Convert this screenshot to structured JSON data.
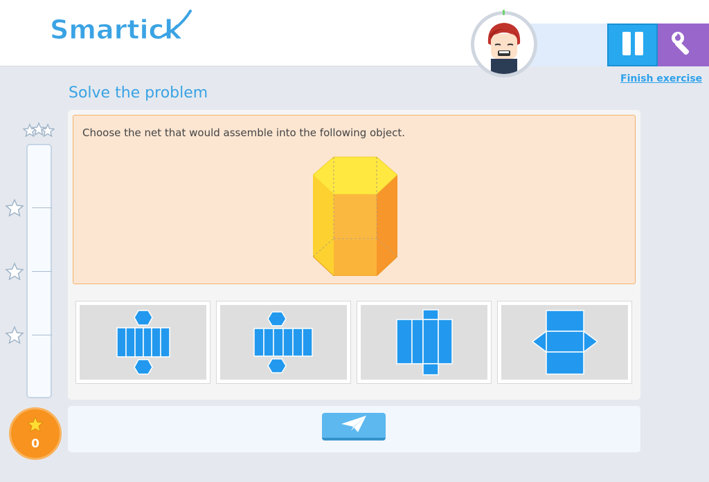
{
  "app": {
    "logo_text": "Smartick"
  },
  "header": {
    "finish_label": "Finish exercise",
    "pause_icon": "pause-icon",
    "settings_icon": "wrench-icon",
    "colors": {
      "pause": "#27a8ef",
      "settings": "#9966cc"
    }
  },
  "main": {
    "title": "Solve the problem",
    "question": "Choose the net that would assemble into the following object.",
    "object_icon": "hexagonal-prism",
    "options": [
      {
        "id": "A",
        "icon": "net-hexagonal-prism"
      },
      {
        "id": "B",
        "icon": "net-hexagonal-prism-variant"
      },
      {
        "id": "C",
        "icon": "net-rectangular-prism"
      },
      {
        "id": "D",
        "icon": "net-triangular-prism"
      }
    ]
  },
  "progress": {
    "milestone_stars": [
      "1-star",
      "2-star",
      "3-star"
    ],
    "goal_stars": "3-star",
    "score_value": "0"
  },
  "submit": {
    "icon": "paper-plane-icon"
  }
}
